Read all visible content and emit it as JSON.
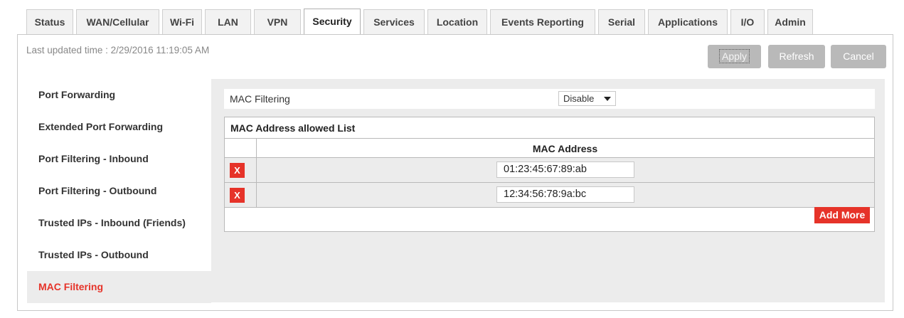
{
  "tabs": [
    {
      "label": "Status"
    },
    {
      "label": "WAN/Cellular"
    },
    {
      "label": "Wi-Fi"
    },
    {
      "label": "LAN"
    },
    {
      "label": "VPN"
    },
    {
      "label": "Security"
    },
    {
      "label": "Services"
    },
    {
      "label": "Location"
    },
    {
      "label": "Events Reporting"
    },
    {
      "label": "Serial"
    },
    {
      "label": "Applications"
    },
    {
      "label": "I/O"
    },
    {
      "label": "Admin"
    }
  ],
  "active_tab": "Security",
  "last_updated": "Last updated time : 2/29/2016 11:19:05 AM",
  "toolbar": {
    "apply_label": "Apply",
    "refresh_label": "Refresh",
    "cancel_label": "Cancel"
  },
  "sidebar": {
    "items": [
      {
        "label": "Port Forwarding"
      },
      {
        "label": "Extended Port Forwarding"
      },
      {
        "label": "Port Filtering - Inbound"
      },
      {
        "label": "Port Filtering - Outbound"
      },
      {
        "label": "Trusted IPs - Inbound (Friends)"
      },
      {
        "label": "Trusted IPs - Outbound"
      },
      {
        "label": "MAC Filtering"
      }
    ],
    "active": "MAC Filtering"
  },
  "mac_filtering": {
    "label": "MAC Filtering",
    "select_value": "Disable"
  },
  "allowed_list": {
    "title": "MAC Address allowed List",
    "column_header": "MAC Address",
    "delete_label": "X",
    "rows": [
      {
        "mac": "01:23:45:67:89:ab"
      },
      {
        "mac": "12:34:56:78:9a:bc"
      }
    ],
    "add_more_label": "Add More"
  },
  "colors": {
    "accent": "#e63329",
    "button_gray": "#b9b9b9",
    "panel_bg": "#ececec"
  }
}
